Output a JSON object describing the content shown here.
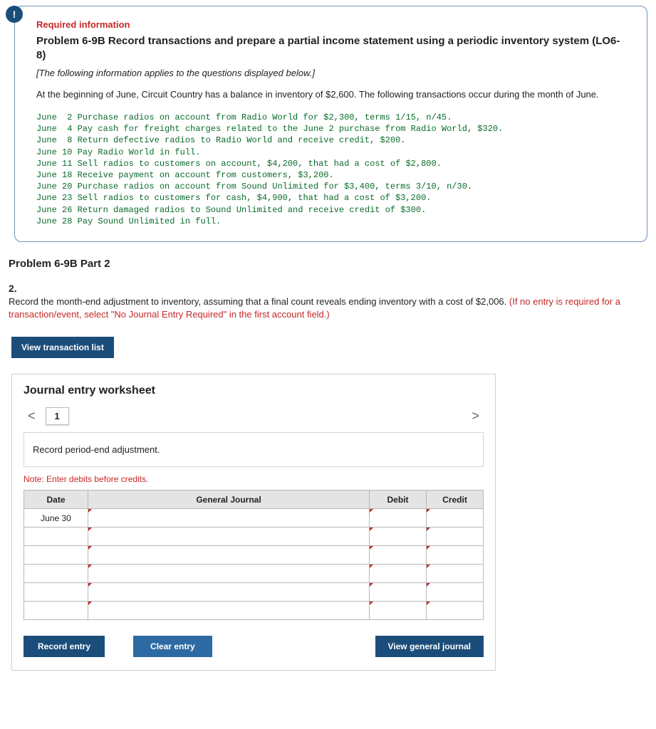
{
  "badge": "!",
  "header": {
    "required": "Required information",
    "title": "Problem 6-9B Record transactions and prepare a partial income statement using a periodic inventory system (LO6-8)",
    "italic": "[The following information applies to the questions displayed below.]",
    "intro": "At the beginning of June, Circuit Country has a balance in inventory of $2,600. The following transactions occur during the month of June.",
    "transactions": "June  2 Purchase radios on account from Radio World for $2,300, terms 1/15, n/45.\nJune  4 Pay cash for freight charges related to the June 2 purchase from Radio World, $320.\nJune  8 Return defective radios to Radio World and receive credit, $200.\nJune 10 Pay Radio World in full.\nJune 11 Sell radios to customers on account, $4,200, that had a cost of $2,800.\nJune 18 Receive payment on account from customers, $3,200.\nJune 20 Purchase radios on account from Sound Unlimited for $3,400, terms 3/10, n/30.\nJune 23 Sell radios to customers for cash, $4,900, that had a cost of $3,200.\nJune 26 Return damaged radios to Sound Unlimited and receive credit of $300.\nJune 28 Pay Sound Unlimited in full."
  },
  "part_title": "Problem 6-9B Part 2",
  "step_num": "2.",
  "instruction_plain": "Record the month-end adjustment to inventory, assuming that a final count reveals ending inventory with a cost of $2,006. ",
  "instruction_red": "(If no entry is required for a transaction/event, select \"No Journal Entry Required\" in the first account field.)",
  "view_list_btn": "View transaction list",
  "worksheet": {
    "heading": "Journal entry worksheet",
    "chev_left": "<",
    "chev_right": ">",
    "tab1": "1",
    "note": "Record period-end adjustment.",
    "debit_note": "Note: Enter debits before credits.",
    "cols": {
      "date": "Date",
      "gj": "General Journal",
      "debit": "Debit",
      "credit": "Credit"
    },
    "row_date": "June 30",
    "buttons": {
      "record": "Record entry",
      "clear": "Clear entry",
      "viewgj": "View general journal"
    }
  }
}
